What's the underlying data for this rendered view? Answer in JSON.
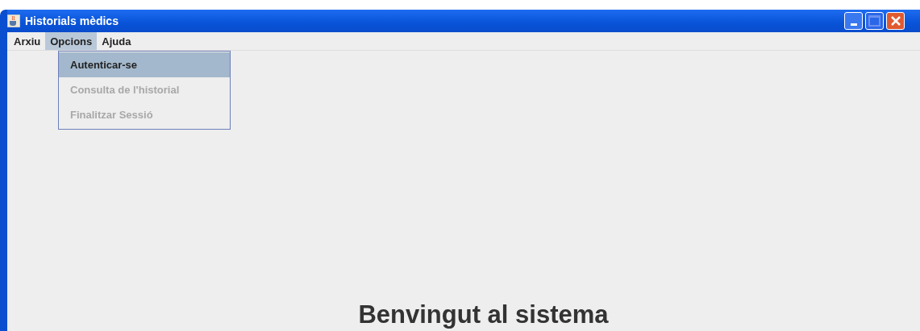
{
  "window": {
    "title": "Historials mèdics"
  },
  "menu_bar": [
    {
      "label": "Arxiu",
      "selected": false
    },
    {
      "label": "Opcions",
      "selected": true
    },
    {
      "label": "Ajuda",
      "selected": false
    }
  ],
  "open_menu": {
    "items": [
      {
        "label": "Autenticar-se",
        "selected": true,
        "disabled": false
      },
      {
        "label": "Consulta de l'historial",
        "selected": false,
        "disabled": true
      },
      {
        "label": "Finalitzar Sessió",
        "selected": false,
        "disabled": true
      }
    ]
  },
  "content": {
    "heading": "Benvingut al sistema"
  }
}
